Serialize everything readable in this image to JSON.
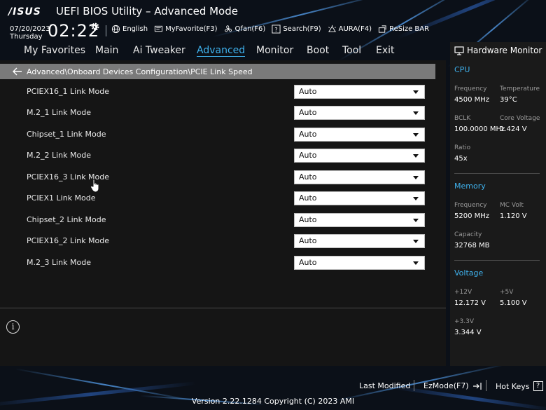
{
  "header": {
    "brand": "/ISUS",
    "title": "UEFI BIOS Utility – Advanced Mode",
    "date": "07/20/2023",
    "day": "Thursday",
    "time": "02:22",
    "tools": [
      {
        "icon": "globe-icon",
        "label": "English"
      },
      {
        "icon": "favorite-icon",
        "label": "MyFavorite(F3)"
      },
      {
        "icon": "fan-icon",
        "label": "Qfan(F6)"
      },
      {
        "icon": "search-icon",
        "label": "Search(F9)"
      },
      {
        "icon": "aura-icon",
        "label": "AURA(F4)"
      },
      {
        "icon": "resize-bar-icon",
        "label": "ReSize BAR"
      }
    ]
  },
  "nav": {
    "items": [
      "My Favorites",
      "Main",
      "Ai Tweaker",
      "Advanced",
      "Monitor",
      "Boot",
      "Tool",
      "Exit"
    ],
    "active": "Advanced"
  },
  "breadcrumb": "Advanced\\Onboard Devices Configuration\\PCIE Link Speed",
  "settings": [
    {
      "label": "PCIEX16_1 Link Mode",
      "value": "Auto"
    },
    {
      "label": "M.2_1 Link Mode",
      "value": "Auto"
    },
    {
      "label": "Chipset_1 Link Mode",
      "value": "Auto"
    },
    {
      "label": "M.2_2 Link Mode",
      "value": "Auto"
    },
    {
      "label": "PCIEX16_3 Link Mode",
      "value": "Auto"
    },
    {
      "label": "PCIEX1 Link Mode",
      "value": "Auto"
    },
    {
      "label": "Chipset_2 Link Mode",
      "value": "Auto"
    },
    {
      "label": "PCIEX16_2 Link Mode",
      "value": "Auto"
    },
    {
      "label": "M.2_3 Link Mode",
      "value": "Auto"
    }
  ],
  "info_icon": "i",
  "hw": {
    "title": "Hardware Monitor",
    "cpu": {
      "section": "CPU",
      "frequency_label": "Frequency",
      "frequency": "4500 MHz",
      "temperature_label": "Temperature",
      "temperature": "39°C",
      "bclk_label": "BCLK",
      "bclk": "100.0000 MHz",
      "core_voltage_label": "Core Voltage",
      "core_voltage": "1.424 V",
      "ratio_label": "Ratio",
      "ratio": "45x"
    },
    "memory": {
      "section": "Memory",
      "frequency_label": "Frequency",
      "frequency": "5200 MHz",
      "mc_volt_label": "MC Volt",
      "mc_volt": "1.120 V",
      "capacity_label": "Capacity",
      "capacity": "32768 MB"
    },
    "voltage": {
      "section": "Voltage",
      "v12_label": "+12V",
      "v12": "12.172 V",
      "v5_label": "+5V",
      "v5": "5.100 V",
      "v33_label": "+3.3V",
      "v33": "3.344 V"
    }
  },
  "footer": {
    "last_modified": "Last Modified",
    "ezmode": "EzMode(F7)",
    "hot_keys": "Hot Keys",
    "hot_keys_key": "?",
    "copyright": "Version 2.22.1284 Copyright (C) 2023 AMI"
  },
  "colors": {
    "accent": "#3fb2ee",
    "panel": "#151515",
    "breadcrumb": "#7a7a7a"
  }
}
